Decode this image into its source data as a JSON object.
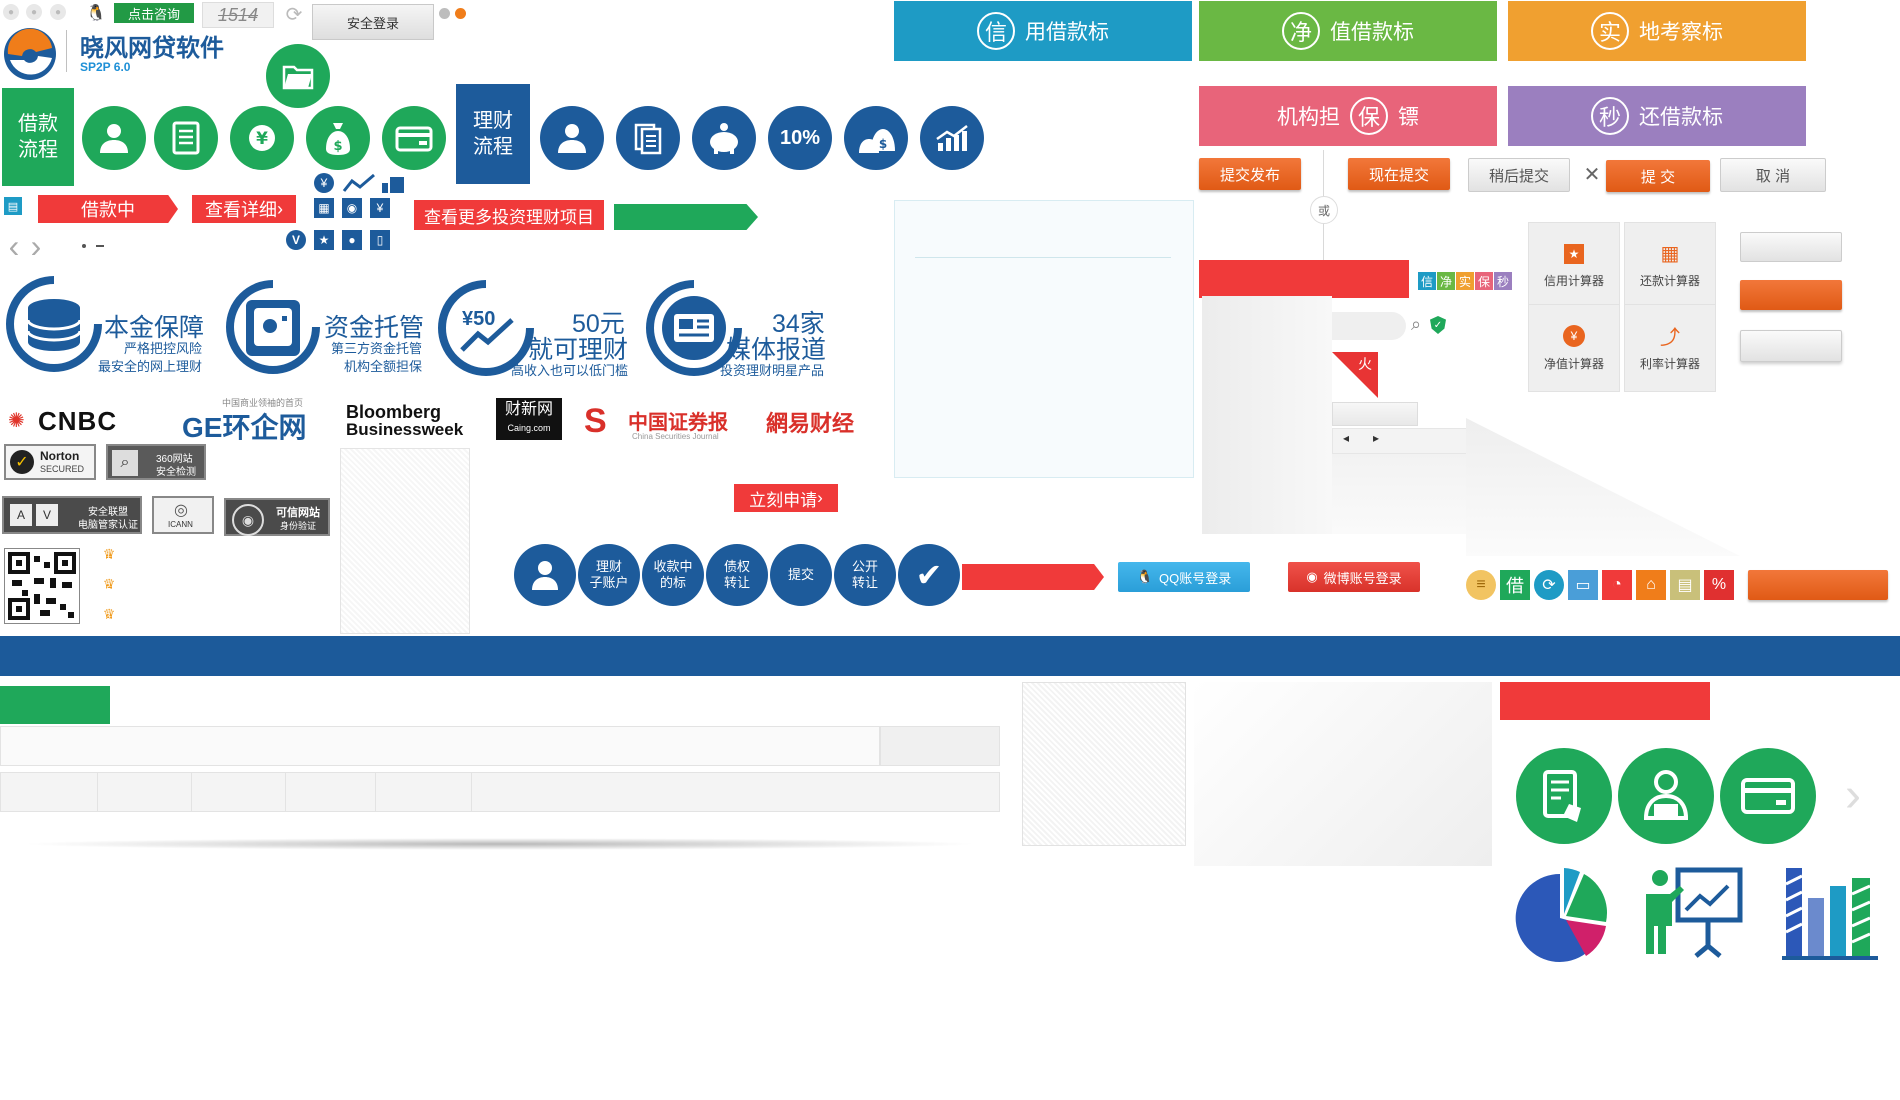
{
  "top_bar": {
    "consult_label": "点击咨询",
    "captcha_text": "1514",
    "secure_login_label": "安全登录"
  },
  "logo": {
    "name": "晓风网贷软件",
    "version": "SP2P 6.0"
  },
  "bid_types": [
    {
      "badge": "信",
      "label": "用借款标",
      "color": "#1e9bc5"
    },
    {
      "badge": "净",
      "label": "值借款标",
      "color": "#6ab844"
    },
    {
      "badge": "实",
      "label": "地考察标",
      "color": "#f0a030"
    },
    {
      "badge": "保",
      "label_before": "机构担",
      "label_after": "镖",
      "color": "#e8647a"
    },
    {
      "badge": "秒",
      "label": "还借款标",
      "color": "#9b7fbf"
    }
  ],
  "loan_flow": {
    "title": "借款流程",
    "title_line1": "借款",
    "title_line2": "流程"
  },
  "invest_flow": {
    "title_line1": "理财",
    "title_line2": "流程"
  },
  "invest_icons": {
    "percent_label": "10%"
  },
  "small_icons": {
    "yen": "¥",
    "v": "V"
  },
  "labels": {
    "borrowing": "借款中",
    "view_detail": "查看详细",
    "view_more_projects": "查看更多投资理财项目",
    "apply_now": "立刻申请",
    "or": "或",
    "fire": "火"
  },
  "actions": {
    "publish": "提交发布",
    "submit_now": "现在提交",
    "submit_later": "稍后提交",
    "submit": "提 交",
    "cancel": "取 消",
    "close_glyph": "✕"
  },
  "mini_tags": [
    "信",
    "净",
    "实",
    "保",
    "秒"
  ],
  "mini_tag_colors": [
    "#1e9bc5",
    "#6ab844",
    "#f0a030",
    "#e8647a",
    "#9b7fbf"
  ],
  "calculators": [
    {
      "label": "信用计算器",
      "icon": "star-icon",
      "glyph": "★"
    },
    {
      "label": "还款计算器",
      "icon": "grid-icon",
      "glyph": "▦"
    },
    {
      "label": "净值计算器",
      "icon": "yen-icon",
      "glyph": "¥"
    },
    {
      "label": "利率计算器",
      "icon": "trend-icon",
      "glyph": "⤴"
    }
  ],
  "features": [
    {
      "title": "本金保障",
      "sub1": "严格把控风险",
      "sub2": "最安全的网上理财"
    },
    {
      "title": "资金托管",
      "sub1": "第三方资金托管",
      "sub2": "机构全额担保"
    },
    {
      "title_line1": "50元",
      "title_line2": "就可理财",
      "badge": "¥50",
      "sub": "高收入也可以低门槛"
    },
    {
      "title_line1": "34家",
      "title_line2": "媒体报道",
      "sub": "投资理财明星产品"
    }
  ],
  "media": {
    "cnbc": "CNBC",
    "ge_small": "中国商业领袖的首页",
    "ge_main": "GE环企网",
    "bloomberg_line1": "Bloomberg",
    "bloomberg_line2": "Businessweek",
    "caixin_line1": "财新网",
    "caixin_line2": "Caing.com",
    "securities_main": "中国证券报",
    "securities_sub": "China Securities Journal",
    "netease": "網易财经"
  },
  "badges": {
    "norton_line1": "Norton",
    "norton_line2": "SECURED",
    "s360_line1": "360网站",
    "s360_line2": "安全检测",
    "alliance_line1": "安全联盟",
    "alliance_line2": "电脑管家认证",
    "icann": "ICANN",
    "trusted_line1": "可信网站",
    "trusted_line2": "身份验证"
  },
  "ranks": [
    "1",
    "2",
    "3"
  ],
  "steps": [
    {
      "line1": "理财",
      "line2": "子账户"
    },
    {
      "line1": "收款中",
      "line2": "的标"
    },
    {
      "line1": "债权",
      "line2": "转让"
    },
    {
      "line1": "提交",
      "line2": ""
    },
    {
      "line1": "公开",
      "line2": "转让"
    }
  ],
  "social": {
    "qq_login": "QQ账号登录",
    "weibo_login": "微博账号登录"
  },
  "mini_icon_row": {
    "jie": "借"
  },
  "colors": {
    "brand_blue": "#1d5b9b",
    "brand_green": "#1fa85a",
    "red": "#f03a3a",
    "orange": "#e9651f"
  }
}
